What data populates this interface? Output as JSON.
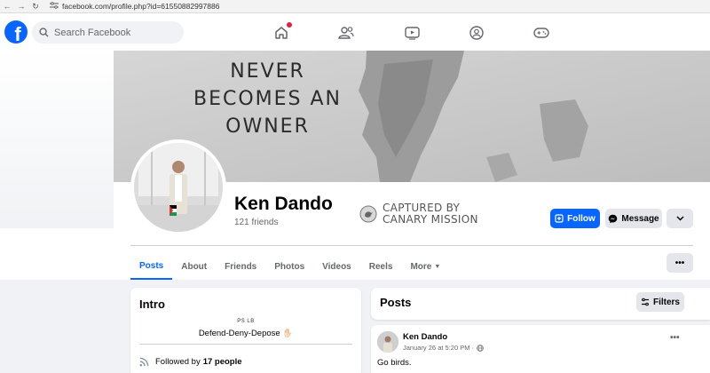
{
  "browser": {
    "url": "facebook.com/profile.php?id=61550882997886"
  },
  "topnav": {
    "logo_letter": "f",
    "search_placeholder": "Search Facebook"
  },
  "cover": {
    "line1": "NEVER",
    "line2": "BECOMES AN",
    "line3": "OWNER"
  },
  "profile": {
    "name": "Ken Dando",
    "friends": "121 friends",
    "watermark_line1": "CAPTURED BY",
    "watermark_line2": "CANARY MISSION"
  },
  "actions": {
    "follow_label": "Follow",
    "message_label": "Message"
  },
  "tabs": [
    {
      "label": "Posts"
    },
    {
      "label": "About"
    },
    {
      "label": "Friends"
    },
    {
      "label": "Photos"
    },
    {
      "label": "Videos"
    },
    {
      "label": "Reels"
    },
    {
      "label": "More"
    }
  ],
  "intro": {
    "title": "Intro",
    "bio_top": "PS LB",
    "bio": "Defend-Deny-Depose ✋🏻",
    "followed_prefix": "Followed by",
    "followed_count": "17 people"
  },
  "posts": {
    "title": "Posts",
    "filters_label": "Filters",
    "items": [
      {
        "author": "Ken Dando",
        "date": "January 26 at 5:20 PM ·",
        "text": "Go birds."
      }
    ]
  },
  "colors": {
    "brand_blue": "#0866ff",
    "notification_red": "#e41e3f"
  }
}
